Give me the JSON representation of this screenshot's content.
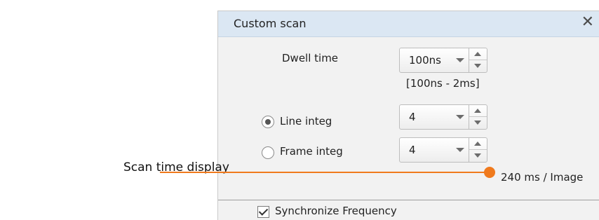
{
  "panel": {
    "title": "Custom scan",
    "close_icon": "close-icon"
  },
  "dwell": {
    "label": "Dwell time",
    "value": "100ns",
    "range": "[100ns - 2ms]"
  },
  "line_integ": {
    "label": "Line integ",
    "value": "4",
    "selected": true
  },
  "frame_integ": {
    "label": "Frame integ",
    "value": "4",
    "selected": false
  },
  "scan_time": {
    "value": "240 ms / Image"
  },
  "sync": {
    "label": "Synchronize Frequency",
    "checked": true
  },
  "annotation": {
    "label": "Scan time display",
    "color": "#f07a1d"
  }
}
